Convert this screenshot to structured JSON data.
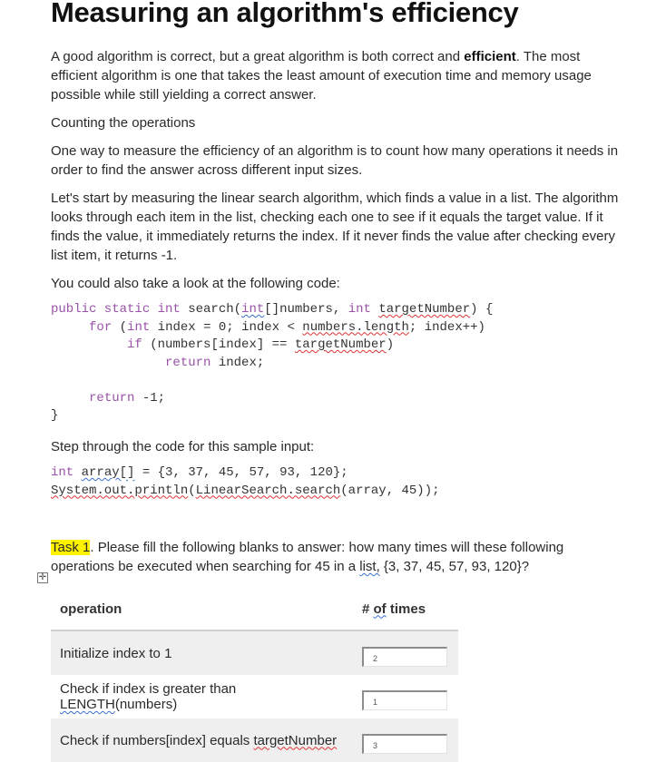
{
  "document": {
    "title": "Measuring an algorithm's efficiency",
    "intro": {
      "before_bold": "A good algorithm is correct, but a great algorithm is both correct and ",
      "bold": "efficient",
      "after_bold": ". The most efficient algorithm is one that takes the least amount of execution time and memory usage possible while still yielding a correct answer."
    },
    "subheading": "Counting the operations",
    "para_count": "One way to measure the efficiency of an algorithm is to count how many operations it needs in order to find the answer across different input sizes.",
    "para_linear": "Let's start by measuring the linear search algorithm, which finds a value in a list. The algorithm looks through each item in the list, checking each one to see if it equals the target value. If it finds the value, it immediately returns the index. If it never finds the value after checking every list item, it returns -1.",
    "para_code_intro": "You could also take a look at the following code:",
    "code": {
      "l1_kw": "public static int",
      "l1_a": " search(",
      "l1_int": "int",
      "l1_b": "[]numbers, ",
      "l1_kw2": "int",
      "l1_sp": " ",
      "l1_target": "targetNumber",
      "l1_c": ") {",
      "l2_indent": "     ",
      "l2_for": "for",
      "l2_a": " (",
      "l2_int": "int",
      "l2_b": " index = 0; index < ",
      "l2_len": "numbers.length",
      "l2_c": "; index++)",
      "l3_indent": "          ",
      "l3_if": "if",
      "l3_a": " (numbers[index] == ",
      "l3_target": "targetNumber",
      "l3_b": ")",
      "l4_indent": "               ",
      "l4_ret": "return",
      "l4_a": " index;",
      "l6_indent": "     ",
      "l6_ret": "return",
      "l6_a": " -1;",
      "l7": "}"
    },
    "para_step": "Step through the code for this sample input:",
    "sample": {
      "l1_int": "int",
      "l1_sp": " ",
      "l1_arr": "array[]",
      "l1_rest": " = {3, 37, 45, 57, 93, 120};",
      "l2_sys": "System.out.println",
      "l2_paren": "(",
      "l2_ls": "LinearSearch.search",
      "l2_rest": "(array, 45));"
    },
    "task": {
      "label": "Task 1",
      "text_a": ". Please fill the following blanks to answer: how many times will these following operations be executed when searching for 45 in a ",
      "list_word": "list,",
      "text_b": "  {3, 37, 45, 57, 93, 120}?"
    },
    "table_move_icon": "table-move-handle-icon",
    "table": {
      "headers": {
        "operation": "operation",
        "times_prefix": "# ",
        "times_of": "of",
        "times_suffix": " times"
      },
      "rows": [
        {
          "op": "Initialize index to 1",
          "value": "2"
        },
        {
          "op_a": "Check if index is greater than ",
          "op_sq": "LENGTH",
          "op_b": "(numbers)",
          "value": "1"
        },
        {
          "op_a": "Check if numbers[index] equals ",
          "op_sq": "targetNumber",
          "value": "3"
        }
      ]
    }
  }
}
